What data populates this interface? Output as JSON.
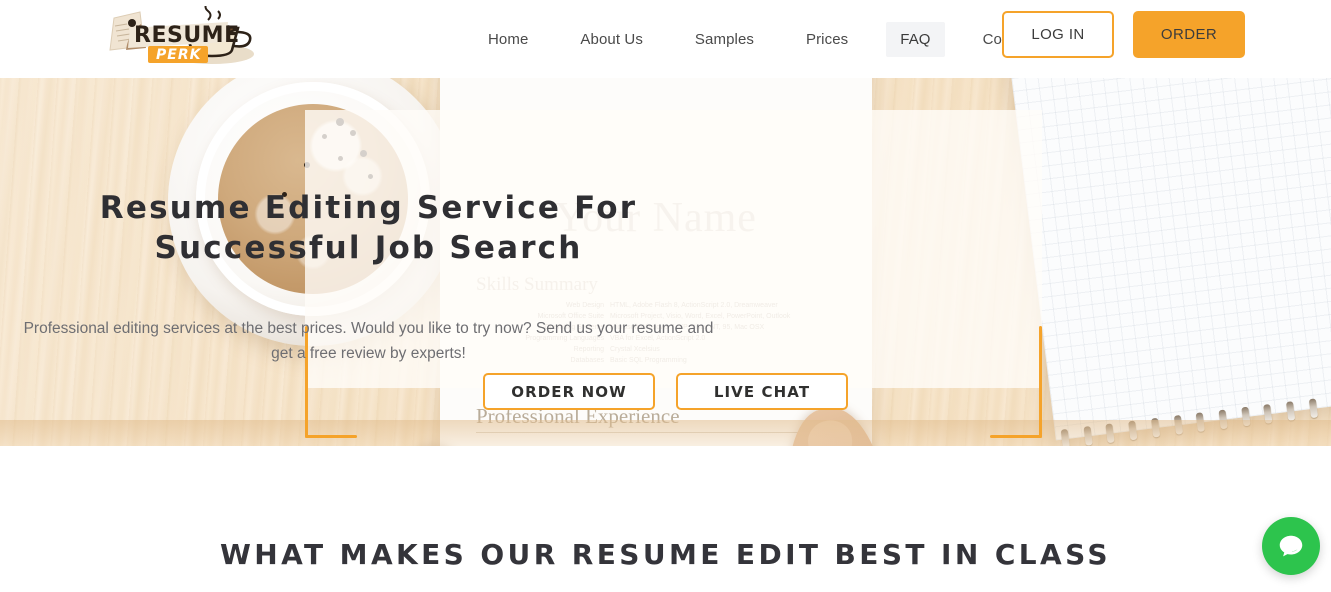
{
  "brand": {
    "name_top": "RESUME",
    "name_badge": "PERK",
    "logo_icon": "resume-coffee-logo"
  },
  "header": {
    "nav": [
      {
        "label": "Home",
        "name": "nav-home",
        "active": false
      },
      {
        "label": "About Us",
        "name": "nav-about-us",
        "active": false
      },
      {
        "label": "Samples",
        "name": "nav-samples",
        "active": false
      },
      {
        "label": "Prices",
        "name": "nav-prices",
        "active": false
      },
      {
        "label": "FAQ",
        "name": "nav-faq",
        "active": true
      },
      {
        "label": "Contact us",
        "name": "nav-contact-us",
        "active": false
      }
    ],
    "login_label": "LOG IN",
    "order_label": "ORDER"
  },
  "hero": {
    "title": "Resume Editing Service For Successful Job Search",
    "subtitle": "Professional editing services at the best prices. Would you like to try now? Send us your resume and get a free review by experts!",
    "order_now_label": "ORDER NOW",
    "live_chat_label": "LIVE CHAT",
    "background_image": "hands-holding-resume-on-wooden-desk-with-coffee-and-notebook"
  },
  "resume_doc": {
    "name_placeholder": "Your Name",
    "skills_heading": "Skills Summary",
    "experience_heading": "Professional Experience",
    "rows": [
      {
        "key": "Web Design",
        "value": "HTML, Adobe Flash 8, ActionScript 2.0, Dreamweaver"
      },
      {
        "key": "Microsoft Office Suite",
        "value": "Microsoft Project, Visio, Word, Excel, PowerPoint, Outlook"
      },
      {
        "key": "Operating Systems",
        "value": "Microsoft Windows 7, XP, Vista, NT, 95, Mac OSX"
      },
      {
        "key": "Programming Languages",
        "value": "VBA for Excel, ActionScript 2.0"
      },
      {
        "key": "Reporting",
        "value": "Crystal Xcelsius"
      },
      {
        "key": "Databases",
        "value": "Basic SQL Programming"
      }
    ]
  },
  "section": {
    "title": "WHAT MAKES OUR RESUME EDIT BEST IN CLASS"
  },
  "chat_widget": {
    "icon": "chat-bubble-icon",
    "color": "#2dc44d"
  },
  "colors": {
    "accent_orange": "#f5a32a",
    "text_dark": "#34343a",
    "nav_text": "#4a4a4a",
    "hero_sub_text": "#6e6e72",
    "chat_green": "#2dc44d"
  }
}
